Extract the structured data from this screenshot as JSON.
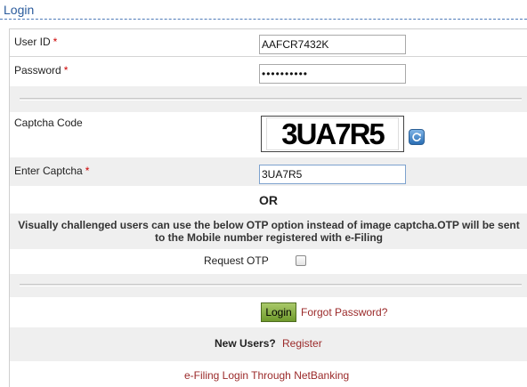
{
  "header": {
    "title": "Login"
  },
  "form": {
    "user_id": {
      "label": "User ID",
      "required_mark": "*",
      "value": "AAFCR7432K"
    },
    "password": {
      "label": "Password",
      "required_mark": "*",
      "value": "••••••••••"
    },
    "captcha": {
      "label": "Captcha Code",
      "image_text": "3UA7R5",
      "refresh_icon": "refresh-icon"
    },
    "enter_captcha": {
      "label": "Enter Captcha",
      "required_mark": "*",
      "value": "3UA7R5"
    },
    "or_text": "OR",
    "otp_notice": "Visually challenged users can use the below OTP option instead of image captcha.OTP will be sent to the Mobile number registered with e-Filing",
    "request_otp": {
      "label": "Request OTP",
      "checked": false
    },
    "login_button": "Login",
    "forgot_password": "Forgot Password?",
    "new_users": {
      "label": "New Users?",
      "link": "Register"
    },
    "netbanking_link": "e-Filing Login Through NetBanking"
  },
  "colors": {
    "title": "#2a5b9c",
    "link": "#9b2a2a",
    "required": "#cc0000",
    "row_grey": "#efefef",
    "login_button": "#7fa63a"
  }
}
